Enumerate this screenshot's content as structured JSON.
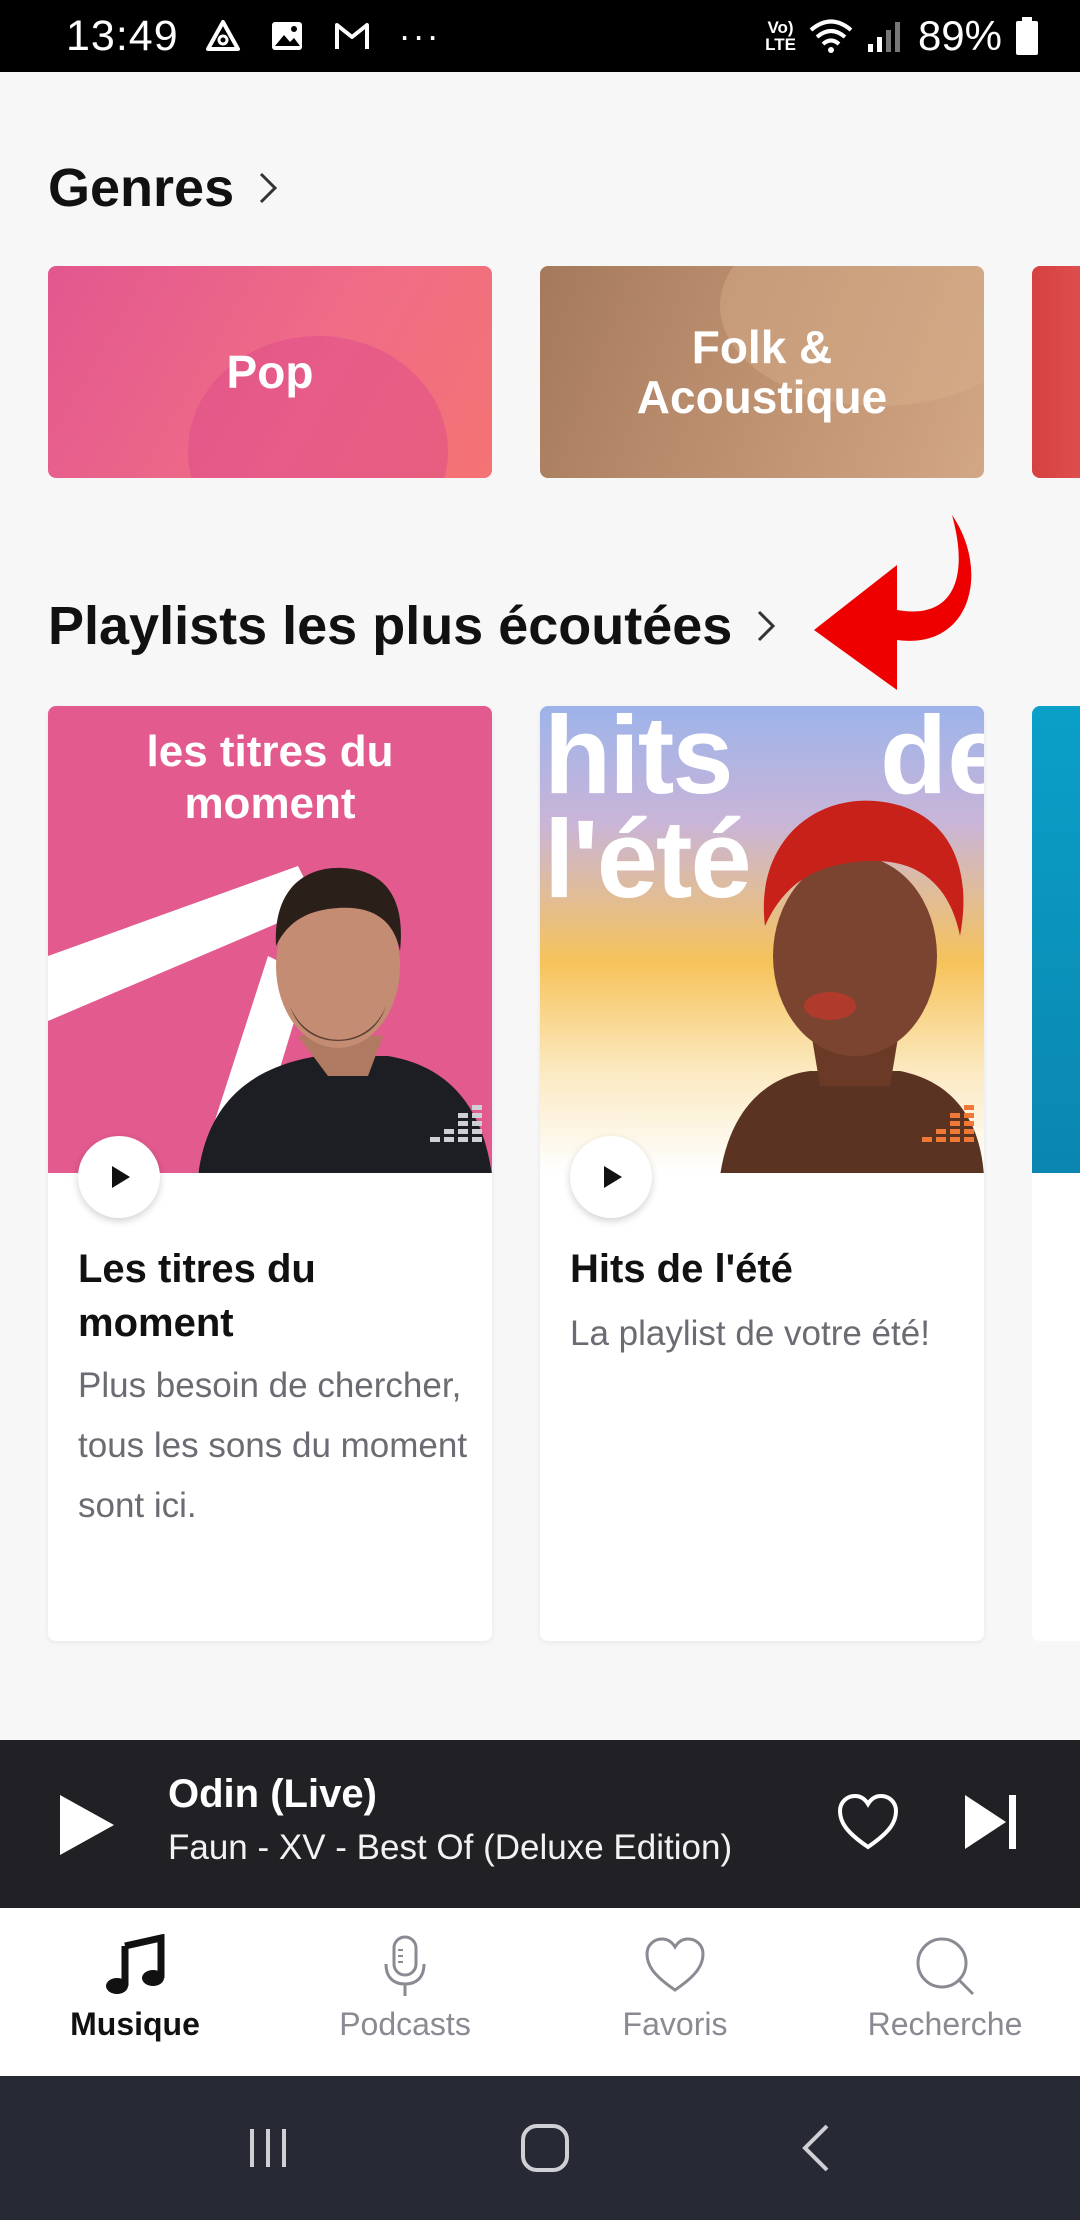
{
  "status_bar": {
    "time": "13:49",
    "volte": "Vo)) LTE",
    "battery": "89%",
    "ellipsis": "···"
  },
  "genres": {
    "title": "Genres",
    "items": [
      {
        "label": "Pop"
      },
      {
        "label": "Folk & Acoustique"
      }
    ]
  },
  "playlists": {
    "title": "Playlists les plus écoutées",
    "items": [
      {
        "cover_text": "les titres du moment",
        "title": "Les titres du moment",
        "description": "Plus besoin de chercher, tous les sons du moment sont ici."
      },
      {
        "cover_text_left": "hits l'été",
        "cover_text_right": "de",
        "title": "Hits de l'été",
        "description": "La playlist de votre été!"
      }
    ]
  },
  "player": {
    "track": "Odin (Live)",
    "subtitle": "Faun - XV - Best Of (Deluxe Edition)"
  },
  "bottom_nav": [
    {
      "label": "Musique",
      "icon": "music-note-icon",
      "active": true
    },
    {
      "label": "Podcasts",
      "icon": "microphone-icon",
      "active": false
    },
    {
      "label": "Favoris",
      "icon": "heart-icon",
      "active": false
    },
    {
      "label": "Recherche",
      "icon": "search-icon",
      "active": false
    }
  ],
  "colors": {
    "accent_pink": "#e25a8e",
    "player_bg": "#212125",
    "annotation_arrow": "#ee0000"
  }
}
